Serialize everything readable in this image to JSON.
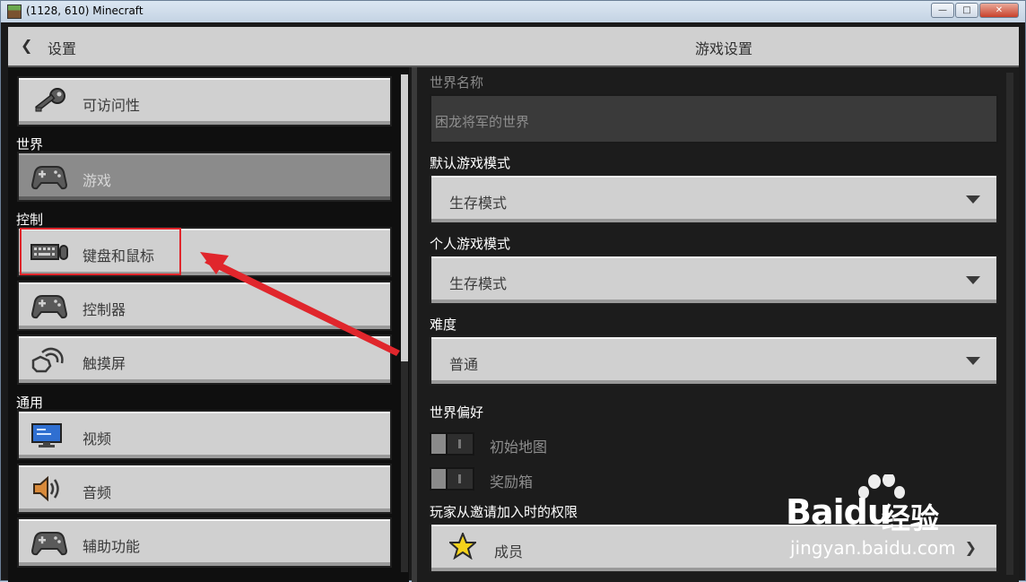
{
  "window": {
    "title": "(1128, 610) Minecraft",
    "controls": {
      "minimize": "—",
      "maximize": "□",
      "close": "✕"
    }
  },
  "header": {
    "back_icon": "chevron-left-icon",
    "back_label": "设置",
    "title": "游戏设置"
  },
  "sidebar": {
    "items": [
      {
        "label": "可访问性",
        "icon": "key-icon"
      },
      {
        "label": "游戏",
        "icon": "gamepad-icon"
      },
      {
        "label": "键盘和鼠标",
        "icon": "keyboard-mouse-icon"
      },
      {
        "label": "控制器",
        "icon": "controller-icon"
      },
      {
        "label": "触摸屏",
        "icon": "touch-icon"
      },
      {
        "label": "视频",
        "icon": "monitor-icon"
      },
      {
        "label": "音频",
        "icon": "speaker-icon"
      },
      {
        "label": "辅助功能",
        "icon": "controller-icon"
      }
    ],
    "sections": {
      "world": "世界",
      "controls": "控制",
      "general": "通用"
    },
    "selected": "游戏"
  },
  "main": {
    "world_name": {
      "label": "世界名称",
      "value": "困龙将军的世界"
    },
    "default_game_mode": {
      "label": "默认游戏模式",
      "value": "生存模式"
    },
    "personal_game_mode": {
      "label": "个人游戏模式",
      "value": "生存模式"
    },
    "difficulty": {
      "label": "难度",
      "value": "普通"
    },
    "world_preferences": {
      "label": "世界偏好",
      "starting_map": {
        "label": "初始地图",
        "on": false
      },
      "bonus_chest": {
        "label": "奖励箱",
        "on": false
      }
    },
    "invite_permission": {
      "label": "玩家从邀请加入时的权限",
      "value": "成员",
      "icon": "star-icon"
    }
  },
  "annotation": {
    "color": "#e0262c"
  },
  "watermark": {
    "brand": "Bai",
    "brand2": "du",
    "cn": "经验",
    "url": "jingyan.baidu.com"
  },
  "colors": {
    "button_face": "#d0d0d0",
    "selected_face": "#8b8b8b",
    "background": "#1c1c1c",
    "highlight": "#e0262c"
  }
}
